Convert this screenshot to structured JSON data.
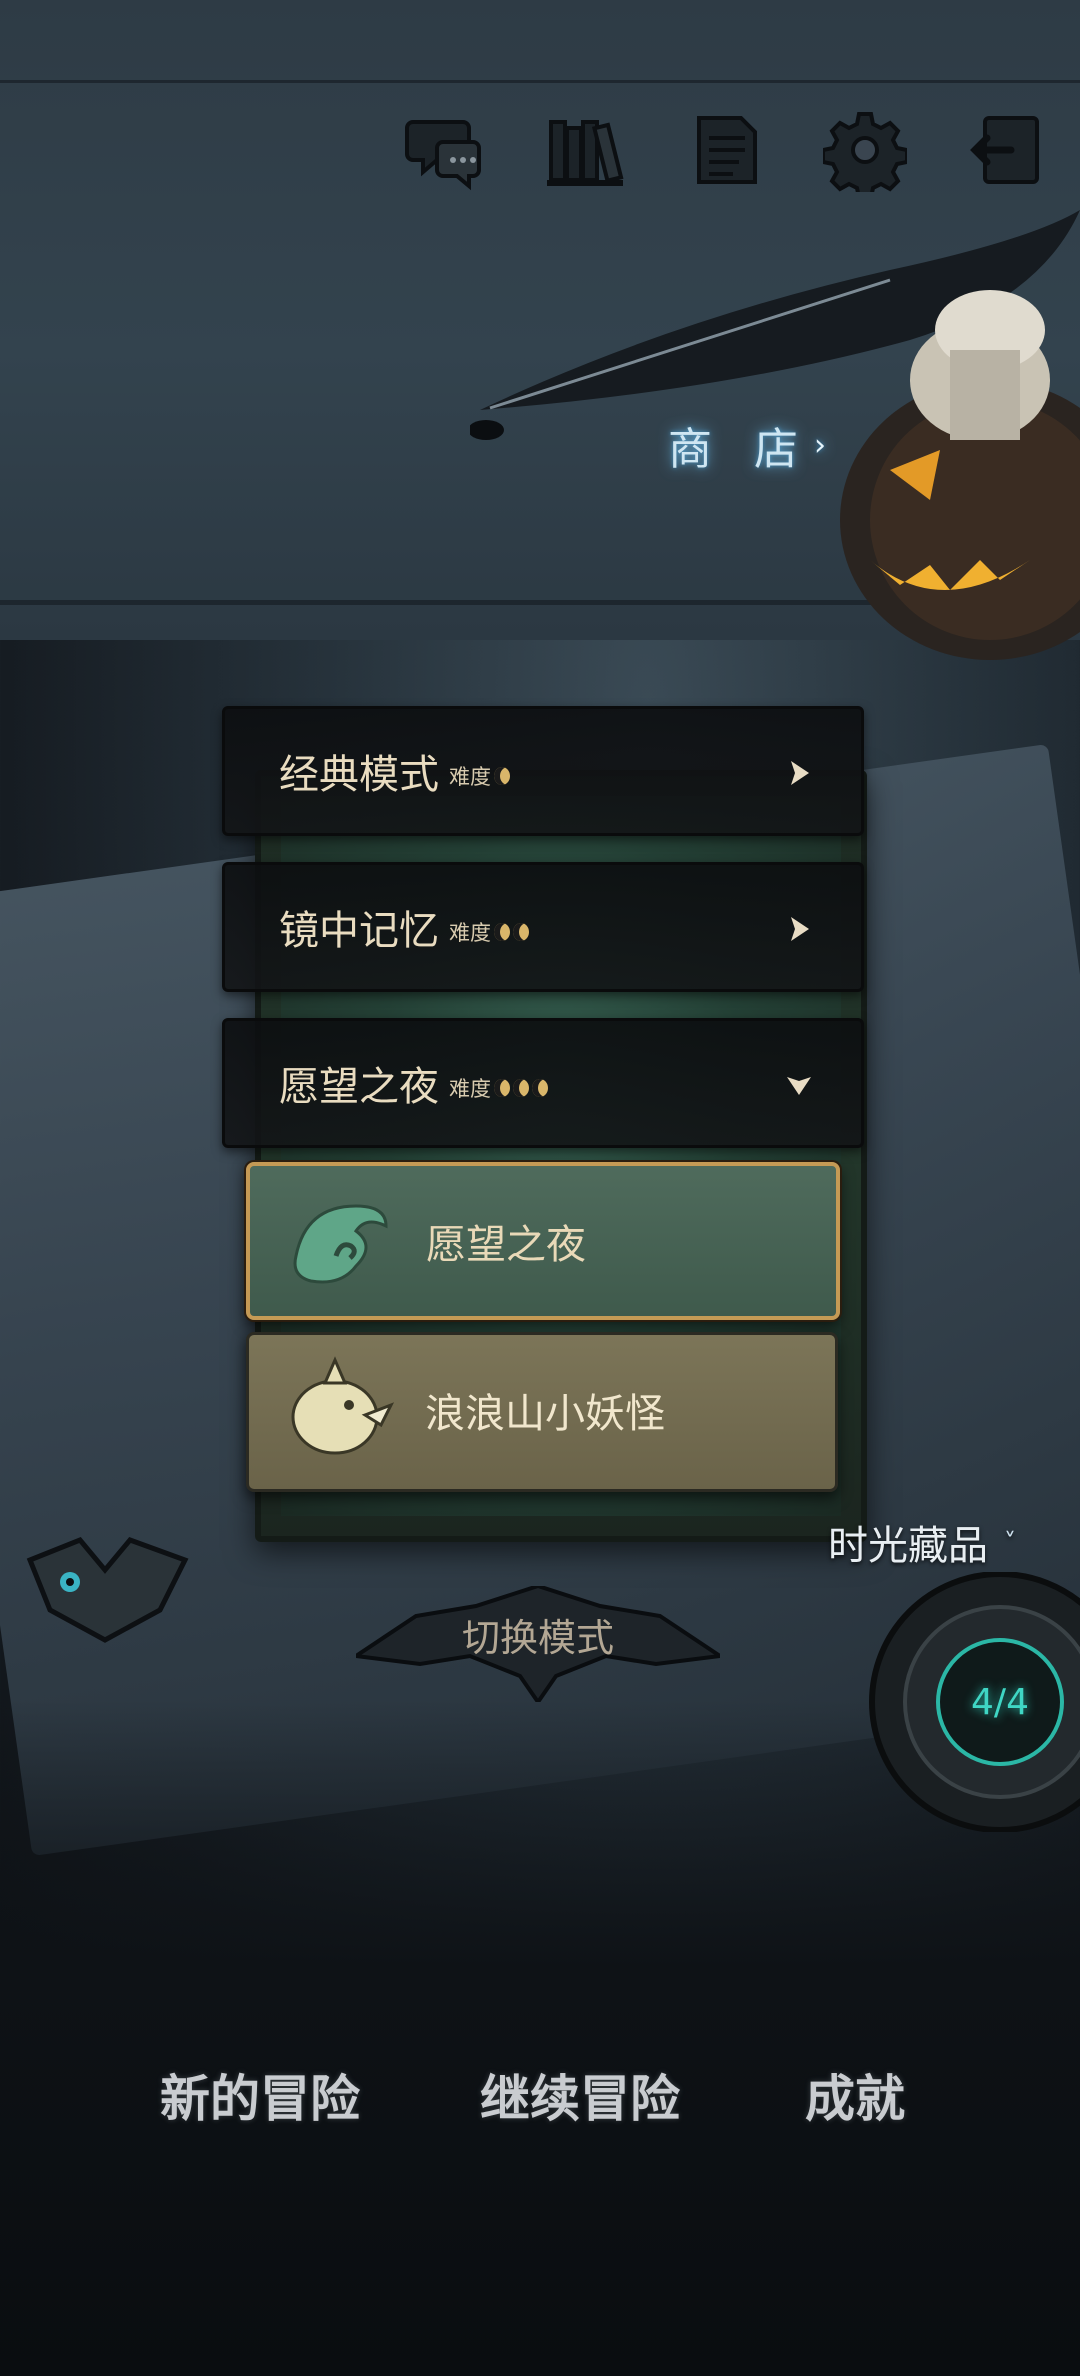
{
  "toolbar": {
    "icons": [
      "chat-icon",
      "library-icon",
      "notes-icon",
      "settings-icon",
      "exit-icon"
    ]
  },
  "shop": {
    "label": "商 店",
    "chevron": "›"
  },
  "modes": [
    {
      "name": "经典模式",
      "difficulty_label": "难度",
      "difficulty_moons": 1,
      "expanded": false
    },
    {
      "name": "镜中记忆",
      "difficulty_label": "难度",
      "difficulty_moons": 2,
      "expanded": false
    },
    {
      "name": "愿望之夜",
      "difficulty_label": "难度",
      "difficulty_moons": 3,
      "expanded": true
    }
  ],
  "sub_options": [
    {
      "label": "愿望之夜",
      "selected": true
    },
    {
      "label": "浪浪山小妖怪",
      "selected": false
    }
  ],
  "collection": {
    "label": "时光藏品",
    "chevron": "˅"
  },
  "switch_mode": {
    "label": "切换模式"
  },
  "progress": {
    "label": "4/4",
    "current": 4,
    "total": 4
  },
  "bottom_menu": {
    "new_adventure": "新的冒险",
    "continue_adventure": "继续冒险",
    "achievements": "成就"
  },
  "colors": {
    "selected_border": "#c59a55",
    "shop_glow": "#6fb6e0",
    "progress_glow": "#3fd6c4"
  }
}
